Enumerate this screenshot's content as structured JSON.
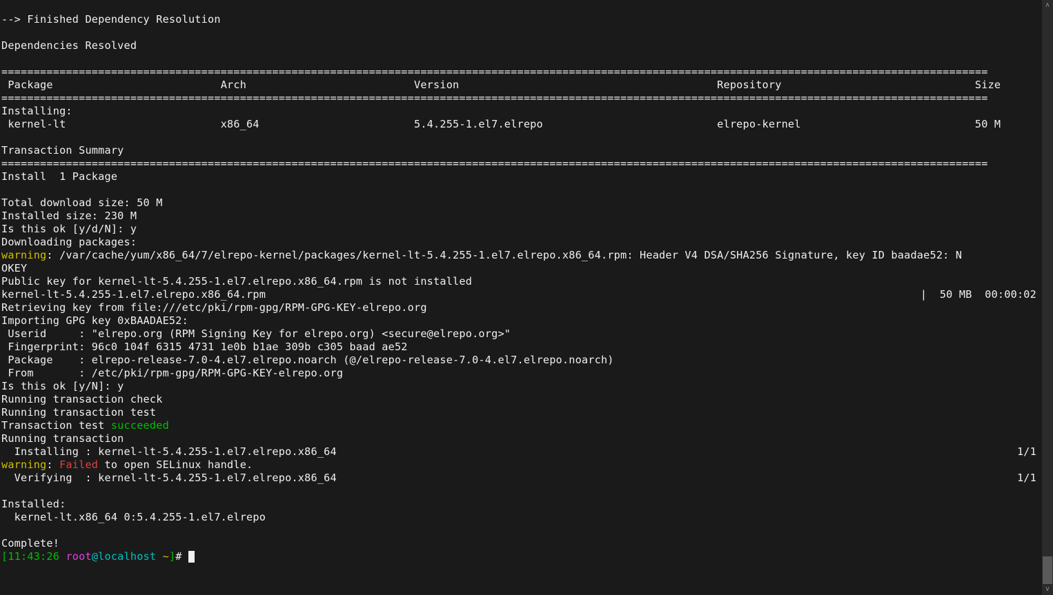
{
  "intro": {
    "l1": "--> Finished Dependency Resolution",
    "l2": "",
    "l3": "Dependencies Resolved",
    "l4": ""
  },
  "divider": "=========================================================================================================================================================",
  "header_row": {
    "package": " Package",
    "arch": "Arch",
    "version": "Version",
    "repository": "Repository",
    "size": "Size"
  },
  "installing_label": "Installing:",
  "pkg": {
    "name": " kernel-lt",
    "arch": "x86_64",
    "version": "5.4.255-1.el7.elrepo",
    "repo": "elrepo-kernel",
    "size": "50 M"
  },
  "tx_summary": "Transaction Summary",
  "install_count": "Install  1 Package",
  "blank": "",
  "dl_size": "Total download size: 50 M",
  "inst_size": "Installed size: 230 M",
  "ok1": "Is this ok [y/d/N]: y",
  "downloading": "Downloading packages:",
  "warn1_pre": "warning",
  "warn1_rest": ": /var/cache/yum/x86_64/7/elrepo-kernel/packages/kernel-lt-5.4.255-1.el7.elrepo.x86_64.rpm: Header V4 DSA/SHA256 Signature, key ID baadae52: N",
  "okey": "OKEY",
  "pubkey": "Public key for kernel-lt-5.4.255-1.el7.elrepo.x86_64.rpm is not installed",
  "rpm_line_left": "kernel-lt-5.4.255-1.el7.elrepo.x86_64.rpm",
  "rpm_line_right": "|  50 MB  00:00:02",
  "retrieve": "Retrieving key from file:///etc/pki/rpm-gpg/RPM-GPG-KEY-elrepo.org",
  "import_key": "Importing GPG key 0xBAADAE52:",
  "userid": " Userid     : \"elrepo.org (RPM Signing Key for elrepo.org) <secure@elrepo.org>\"",
  "fingerprint": " Fingerprint: 96c0 104f 6315 4731 1e0b b1ae 309b c305 baad ae52",
  "gpg_pkg": " Package    : elrepo-release-7.0-4.el7.elrepo.noarch (@/elrepo-release-7.0-4.el7.elrepo.noarch)",
  "gpg_from": " From       : /etc/pki/rpm-gpg/RPM-GPG-KEY-elrepo.org",
  "ok2": "Is this ok [y/N]: y",
  "run_check": "Running transaction check",
  "run_test": "Running transaction test",
  "tx_test_pre": "Transaction test ",
  "succeeded": "succeeded",
  "run_tx": "Running transaction",
  "install_line_left": "  Installing : kernel-lt-5.4.255-1.el7.elrepo.x86_64",
  "one_one": "1/1",
  "warn2_pre": "warning",
  "warn2_sep": ": ",
  "failed": "Failed",
  "warn2_rest": " to open SELinux handle.",
  "verify_left": "  Verifying  : kernel-lt-5.4.255-1.el7.elrepo.x86_64",
  "installed_hdr": "Installed:",
  "installed_pkg": "  kernel-lt.x86_64 0:5.4.255-1.el7.elrepo",
  "complete": "Complete!",
  "prompt": {
    "lbracket": "[",
    "time": "11:43:26",
    "user": "root",
    "at": "@",
    "host": "localhost",
    "cwd": " ~",
    "rbracket": "]",
    "hash": "# "
  }
}
